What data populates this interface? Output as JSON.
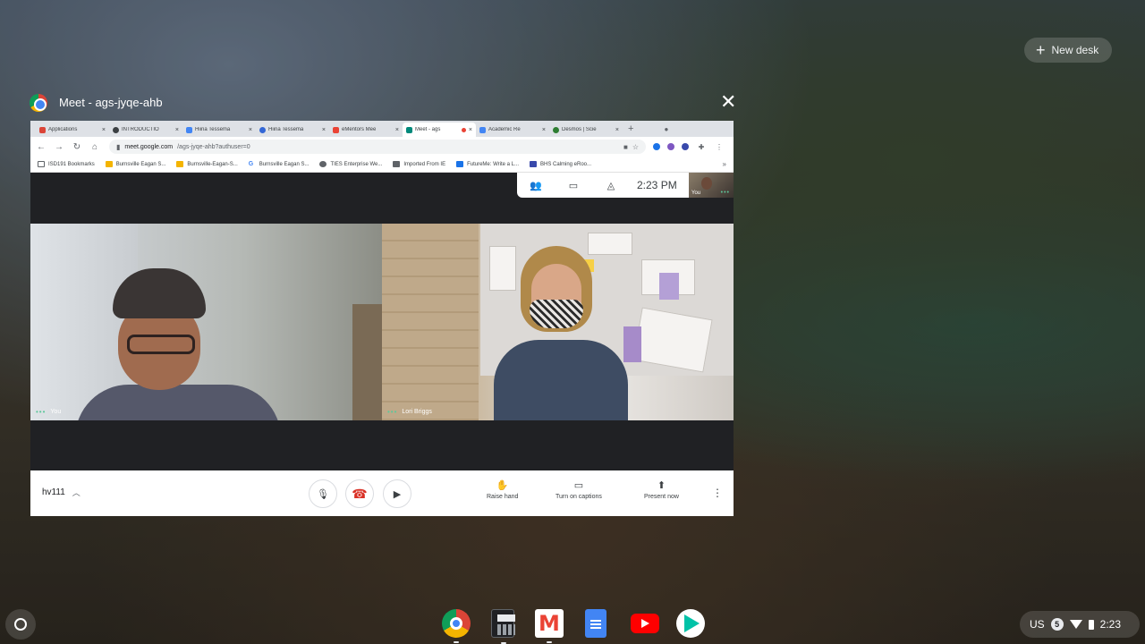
{
  "overview": {
    "new_desk_label": "New desk"
  },
  "window": {
    "title": "Meet - ags-jyqe-ahb",
    "close_glyph": "✕"
  },
  "browser": {
    "tabs": [
      {
        "label": "Applications",
        "fav_color": "#db4437",
        "active": false
      },
      {
        "label": "INTRODUCTIO",
        "fav_color": "#3c4043",
        "active": false
      },
      {
        "label": "Hiina Tessema",
        "fav_color": "#4285f4",
        "active": false
      },
      {
        "label": "Hiina Tessema",
        "fav_color": "#3367d6",
        "active": false
      },
      {
        "label": "eMentors Mee",
        "fav_color": "#ea4335",
        "active": false
      },
      {
        "label": "Meet - ags",
        "fav_color": "#00897b",
        "active": true
      },
      {
        "label": "Academic Re",
        "fav_color": "#4285f4",
        "active": false
      },
      {
        "label": "Desmos | Scie",
        "fav_color": "#2e7d32",
        "active": false
      }
    ],
    "new_tab_glyph": "+",
    "url_host": "meet.google.com",
    "url_path": "/ags-jyqe-ahb?authuser=0",
    "bookmarks": [
      {
        "label": "ISD191 Bookmarks",
        "fav_color": "#5f6368"
      },
      {
        "label": "Burnsville Eagan S...",
        "fav_color": "#f4b400"
      },
      {
        "label": "Burnsville-Eagan-S...",
        "fav_color": "#f4b400"
      },
      {
        "label": "Burnsville Eagan S...",
        "fav_color": "#4285f4"
      },
      {
        "label": "TIES Enterprise We...",
        "fav_color": "#5f6368"
      },
      {
        "label": "Imported From IE",
        "fav_color": "#5f6368"
      },
      {
        "label": "FutureMe: Write a L...",
        "fav_color": "#1a73e8"
      },
      {
        "label": "BHS Calming eRoo...",
        "fav_color": "#3949ab"
      }
    ],
    "bookmarks_more_glyph": "»"
  },
  "meet": {
    "clock": "2:23  PM",
    "self_view_label": "You",
    "participants": [
      {
        "name": "You"
      },
      {
        "name": "Lori Briggs"
      }
    ],
    "meeting_code": "hv111",
    "actions": [
      {
        "label": "Raise hand",
        "icon": "hand-icon"
      },
      {
        "label": "Turn on captions",
        "icon": "captions-icon"
      },
      {
        "label": "Present now",
        "icon": "present-icon"
      }
    ]
  },
  "tray": {
    "keyboard_layout": "US",
    "notification_count": "5",
    "time": "2:23"
  },
  "colors": {
    "meet_dark": "#202124",
    "active_speaker_dots": "#5ec79b",
    "end_call": "#d93025"
  }
}
